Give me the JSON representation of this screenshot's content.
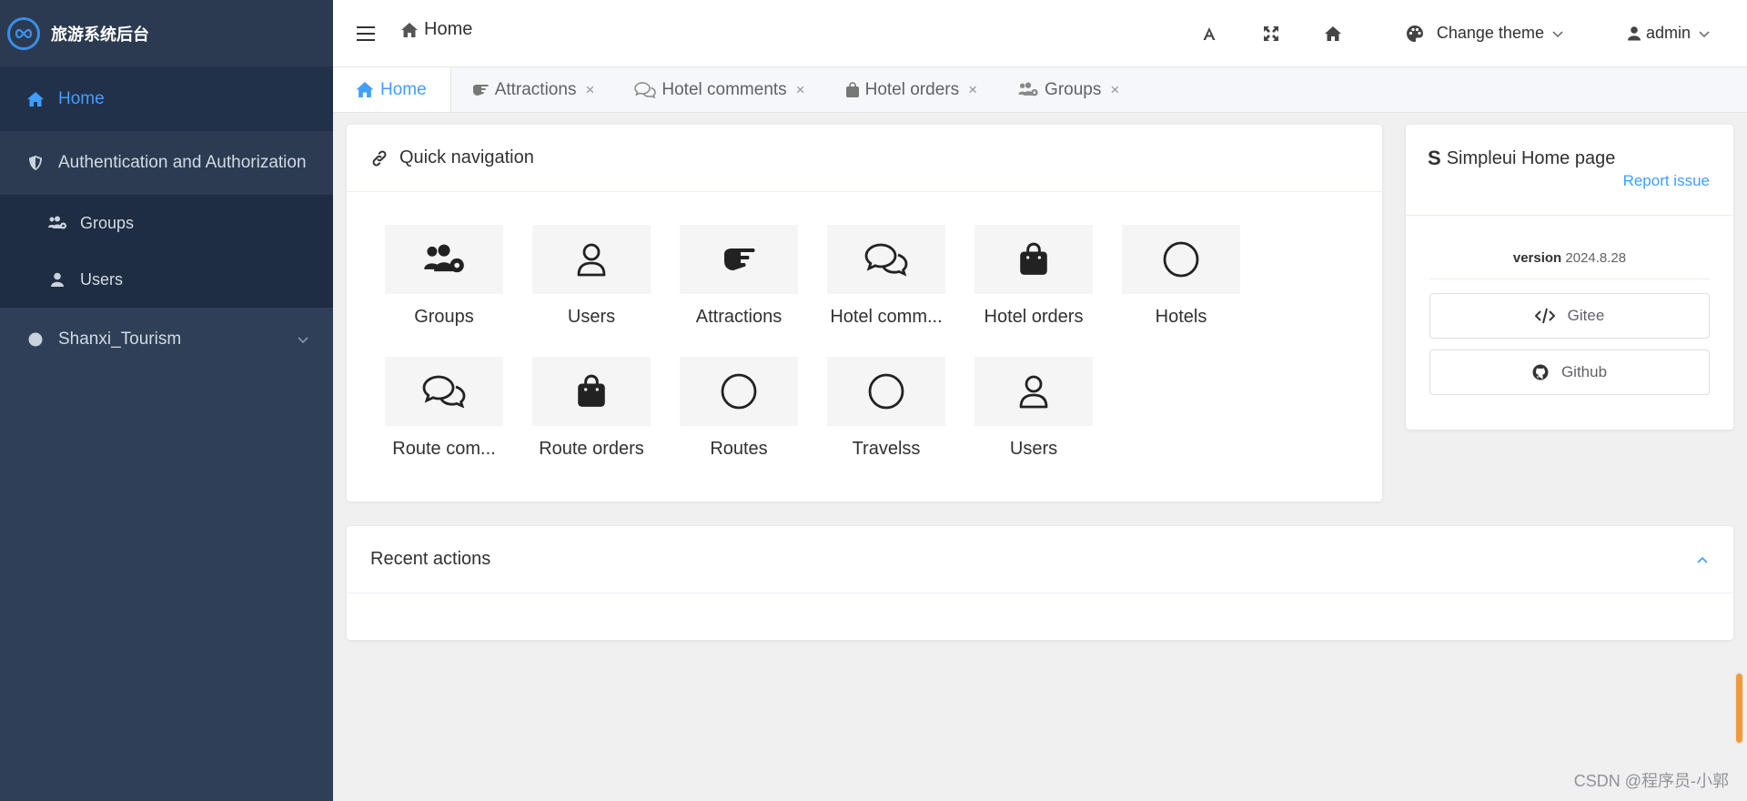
{
  "colors": {
    "accent": "#409eff",
    "sidebar_bg": "#2f3f57",
    "sidebar_active_bg": "#22314a",
    "brand_logo": "#3a8ee6",
    "scroll_indicator": "#f09a3e"
  },
  "sidebar": {
    "brand_title": "旅游系统后台",
    "brand_icon": "infinity-logo",
    "items": [
      {
        "label": "Home",
        "icon": "home-icon",
        "active": true
      },
      {
        "label": "Authentication and Authorization",
        "icon": "shield-icon"
      },
      {
        "label": "Groups",
        "icon": "users-cog-icon"
      },
      {
        "label": "Users",
        "icon": "user-icon"
      },
      {
        "label": "Shanxi_Tourism",
        "icon": "circle-icon"
      }
    ]
  },
  "header": {
    "breadcrumb": "Home",
    "theme_label": "Change theme",
    "user_label": "admin",
    "icons": [
      "menu-icon",
      "font-icon",
      "fullscreen-icon",
      "home-icon",
      "palette-icon",
      "user-icon"
    ]
  },
  "tabs": [
    {
      "label": "Home",
      "icon": "home-icon",
      "active": true,
      "closable": false
    },
    {
      "label": "Attractions",
      "icon": "hand-point-icon",
      "closable": true
    },
    {
      "label": "Hotel comments",
      "icon": "comments-icon",
      "closable": true
    },
    {
      "label": "Hotel orders",
      "icon": "shopping-bag-icon",
      "closable": true
    },
    {
      "label": "Groups",
      "icon": "users-cog-icon",
      "closable": true
    }
  ],
  "tab_close_glyph": "×",
  "quick_nav": {
    "title": "Quick navigation",
    "items": [
      {
        "label": "Groups",
        "icon": "users-cog-icon"
      },
      {
        "label": "Users",
        "icon": "user-icon"
      },
      {
        "label": "Attractions",
        "icon": "hand-point-icon"
      },
      {
        "label": "Hotel comm...",
        "icon": "comments-icon"
      },
      {
        "label": "Hotel orders",
        "icon": "shopping-bag-icon"
      },
      {
        "label": "Hotels",
        "icon": "circle-icon"
      },
      {
        "label": "Route com...",
        "icon": "comments-icon"
      },
      {
        "label": "Route orders",
        "icon": "shopping-bag-icon"
      },
      {
        "label": "Routes",
        "icon": "circle-icon"
      },
      {
        "label": "Travelss",
        "icon": "circle-icon"
      },
      {
        "label": "Users",
        "icon": "user-icon"
      }
    ]
  },
  "simpleui": {
    "logo": "S",
    "title": "Simpleui Home page",
    "report": "Report issue",
    "version_label": "version",
    "version": "2024.8.28",
    "gitee": "Gitee",
    "github": "Github"
  },
  "recent": {
    "title": "Recent actions"
  },
  "watermark": "CSDN @程序员-小郭"
}
